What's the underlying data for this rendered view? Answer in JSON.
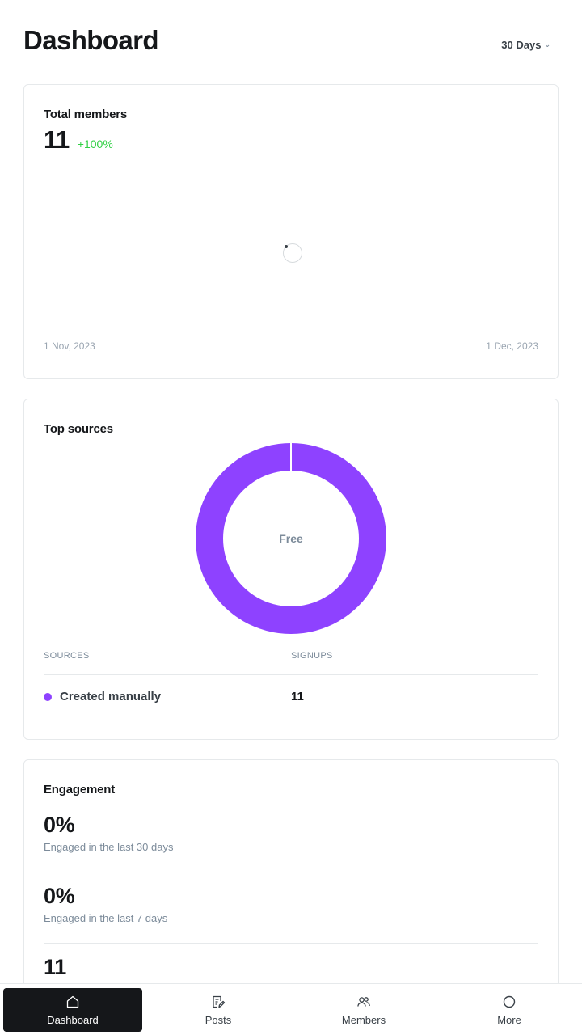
{
  "header": {
    "title": "Dashboard",
    "range_label": "30 Days"
  },
  "members_card": {
    "title": "Total members",
    "value": "11",
    "delta": "+100%",
    "axis_start": "1 Nov, 2023",
    "axis_end": "1 Dec, 2023"
  },
  "sources_card": {
    "title": "Top sources",
    "donut_label": "Free",
    "col_sources": "SOURCES",
    "col_signups": "SIGNUPS",
    "rows": [
      {
        "name": "Created manually",
        "signups": "11"
      }
    ]
  },
  "chart_data": {
    "type": "pie",
    "categories": [
      "Created manually"
    ],
    "values": [
      11
    ],
    "title": "Top sources",
    "center_label": "Free",
    "colors": [
      "#8e42ff"
    ]
  },
  "engagement_card": {
    "title": "Engagement",
    "items": [
      {
        "value": "0%",
        "label": "Engaged in the last 30 days"
      },
      {
        "value": "0%",
        "label": "Engaged in the last 7 days"
      },
      {
        "value": "11",
        "label": ""
      }
    ]
  },
  "bottom_nav": {
    "items": [
      {
        "label": "Dashboard",
        "icon": "home-icon",
        "active": true
      },
      {
        "label": "Posts",
        "icon": "posts-icon",
        "active": false
      },
      {
        "label": "Members",
        "icon": "members-icon",
        "active": false
      },
      {
        "label": "More",
        "icon": "circle-icon",
        "active": false
      }
    ]
  },
  "colors": {
    "accent": "#8e42ff",
    "positive": "#30cf43",
    "text": "#15171a",
    "muted": "#7c8b9a",
    "nav_active_bg": "#15171a"
  }
}
